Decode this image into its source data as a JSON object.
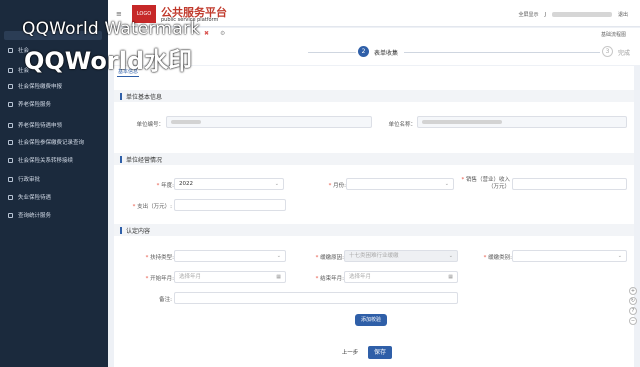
{
  "watermark": {
    "line1": "QQWorld Watermark",
    "line2": "QQWorld水印"
  },
  "header": {
    "menu_icon": "≡",
    "logo_text": "LOGO",
    "title": "公共服务平台",
    "subtitle": "public service platform",
    "right_label": "全屏显示",
    "user_initial": "J",
    "logout": "退出"
  },
  "tabbar": {
    "tab_close": "✖",
    "tab_settings": "⚙",
    "new_process": "基础流程图"
  },
  "steps": [
    {
      "number": "2",
      "label": "表单收集",
      "state": "active"
    },
    {
      "number": "3",
      "label": "完成",
      "state": "pending"
    }
  ],
  "sidebar": {
    "items": [
      {
        "label": "社会保险缴费申报"
      },
      {
        "label": "养老保险服务"
      },
      {
        "label": "养老保险待遇申领"
      },
      {
        "label": "社会保险参保缴费记录查询"
      },
      {
        "label": "社会保险关系转移接续"
      },
      {
        "label": "行政审批"
      },
      {
        "label": "失业保险待遇"
      },
      {
        "label": "查询统计服务"
      }
    ],
    "partial_items": [
      "社会",
      "社会"
    ]
  },
  "content": {
    "subtab": "基本信息",
    "section1": "单位基本信息",
    "unit_code_label": "单位编号：",
    "unit_name_label": "单位名称：",
    "section2": "单位经营情况",
    "year_label": "年度:",
    "year_value": "2022",
    "month_label": "月份:",
    "revenue_label_1": "销售（营业）收入",
    "revenue_label_2": "（万元）",
    "expense_label": "支出（万元）:",
    "section3": "认定内容",
    "category_label": "扶持类型:",
    "reason_label": "缓缴原因:",
    "reason_value": "十七类困难行业缓缴",
    "type_label": "缓缴类别:",
    "start_label": "开始年月:",
    "start_placeholder": "选择年月",
    "end_label": "结束年月:",
    "end_placeholder": "选择年月",
    "remark_label": "备注:",
    "add_button": "添加校验",
    "prev_button": "上一步",
    "save_button": "保存"
  },
  "colors": {
    "sidebar_bg": "#1b2a3d",
    "accent": "#2f5fa8",
    "brand_red": "#c0392b"
  }
}
